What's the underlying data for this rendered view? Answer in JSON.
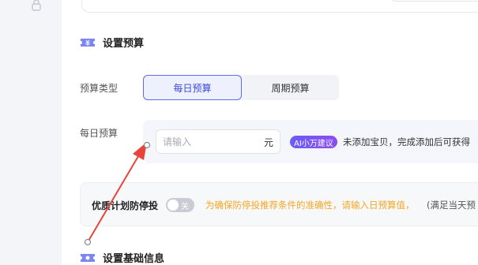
{
  "budget_section": {
    "title": "设置预算",
    "budget_type_label": "预算类型",
    "budget_type_options": [
      "每日预算",
      "周期预算"
    ],
    "selected_option": "每日预算",
    "daily_budget_label": "每日预算",
    "daily_input": {
      "placeholder": "请输入",
      "value": "",
      "unit": "元"
    },
    "ai_badge": "AI小万建议",
    "ai_suggestion": "未添加宝贝，完成添加后可获得"
  },
  "stop_protection": {
    "label": "优质计划防停投",
    "toggle_text": "关",
    "toggle_on": false,
    "warning": "为确保防停投推荐条件的准确性，请输入日预算值，",
    "note": "(满足当天预"
  },
  "basic_section": {
    "title": "设置基础信息"
  },
  "colors": {
    "accent": "#5f6ce8",
    "warning": "#f5a623",
    "annotation_arrow": "#e8443a",
    "ai_badge": "#7a52f5"
  },
  "icons": [
    "lock-icon",
    "budget-section-icon",
    "basic-info-section-icon"
  ]
}
